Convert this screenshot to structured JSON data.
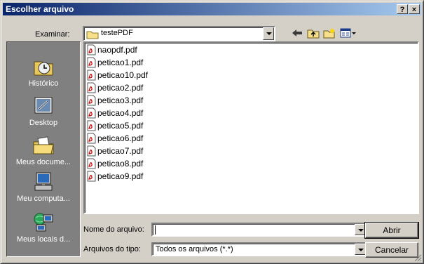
{
  "window": {
    "title": "Escolher arquivo",
    "help_label": "?",
    "close_label": "×"
  },
  "toolbar": {
    "look_in_label": "Examinar:",
    "look_in_value": "testePDF",
    "icons": [
      "back-arrow-icon",
      "up-folder-icon",
      "new-folder-icon",
      "view-menu-icon"
    ]
  },
  "places": [
    {
      "label": "Histórico",
      "icon": "history-icon"
    },
    {
      "label": "Desktop",
      "icon": "desktop-icon"
    },
    {
      "label": "Meus docume...",
      "icon": "my-documents-icon"
    },
    {
      "label": "Meu computa...",
      "icon": "my-computer-icon"
    },
    {
      "label": "Meus locais d...",
      "icon": "network-places-icon"
    }
  ],
  "files": [
    "naopdf.pdf",
    "peticao1.pdf",
    "peticao10.pdf",
    "peticao2.pdf",
    "peticao3.pdf",
    "peticao4.pdf",
    "peticao5.pdf",
    "peticao6.pdf",
    "peticao7.pdf",
    "peticao8.pdf",
    "peticao9.pdf"
  ],
  "form": {
    "filename_label": "Nome do arquivo:",
    "filename_value": "",
    "filetype_label": "Arquivos do tipo:",
    "filetype_value": "Todos os arquivos (*.*)"
  },
  "buttons": {
    "open": "Abrir",
    "cancel": "Cancelar"
  },
  "colors": {
    "titlebar_start": "#0a246a",
    "titlebar_end": "#a6caf0",
    "dialog_bg": "#d4d0c8",
    "places_bg": "#808080"
  }
}
